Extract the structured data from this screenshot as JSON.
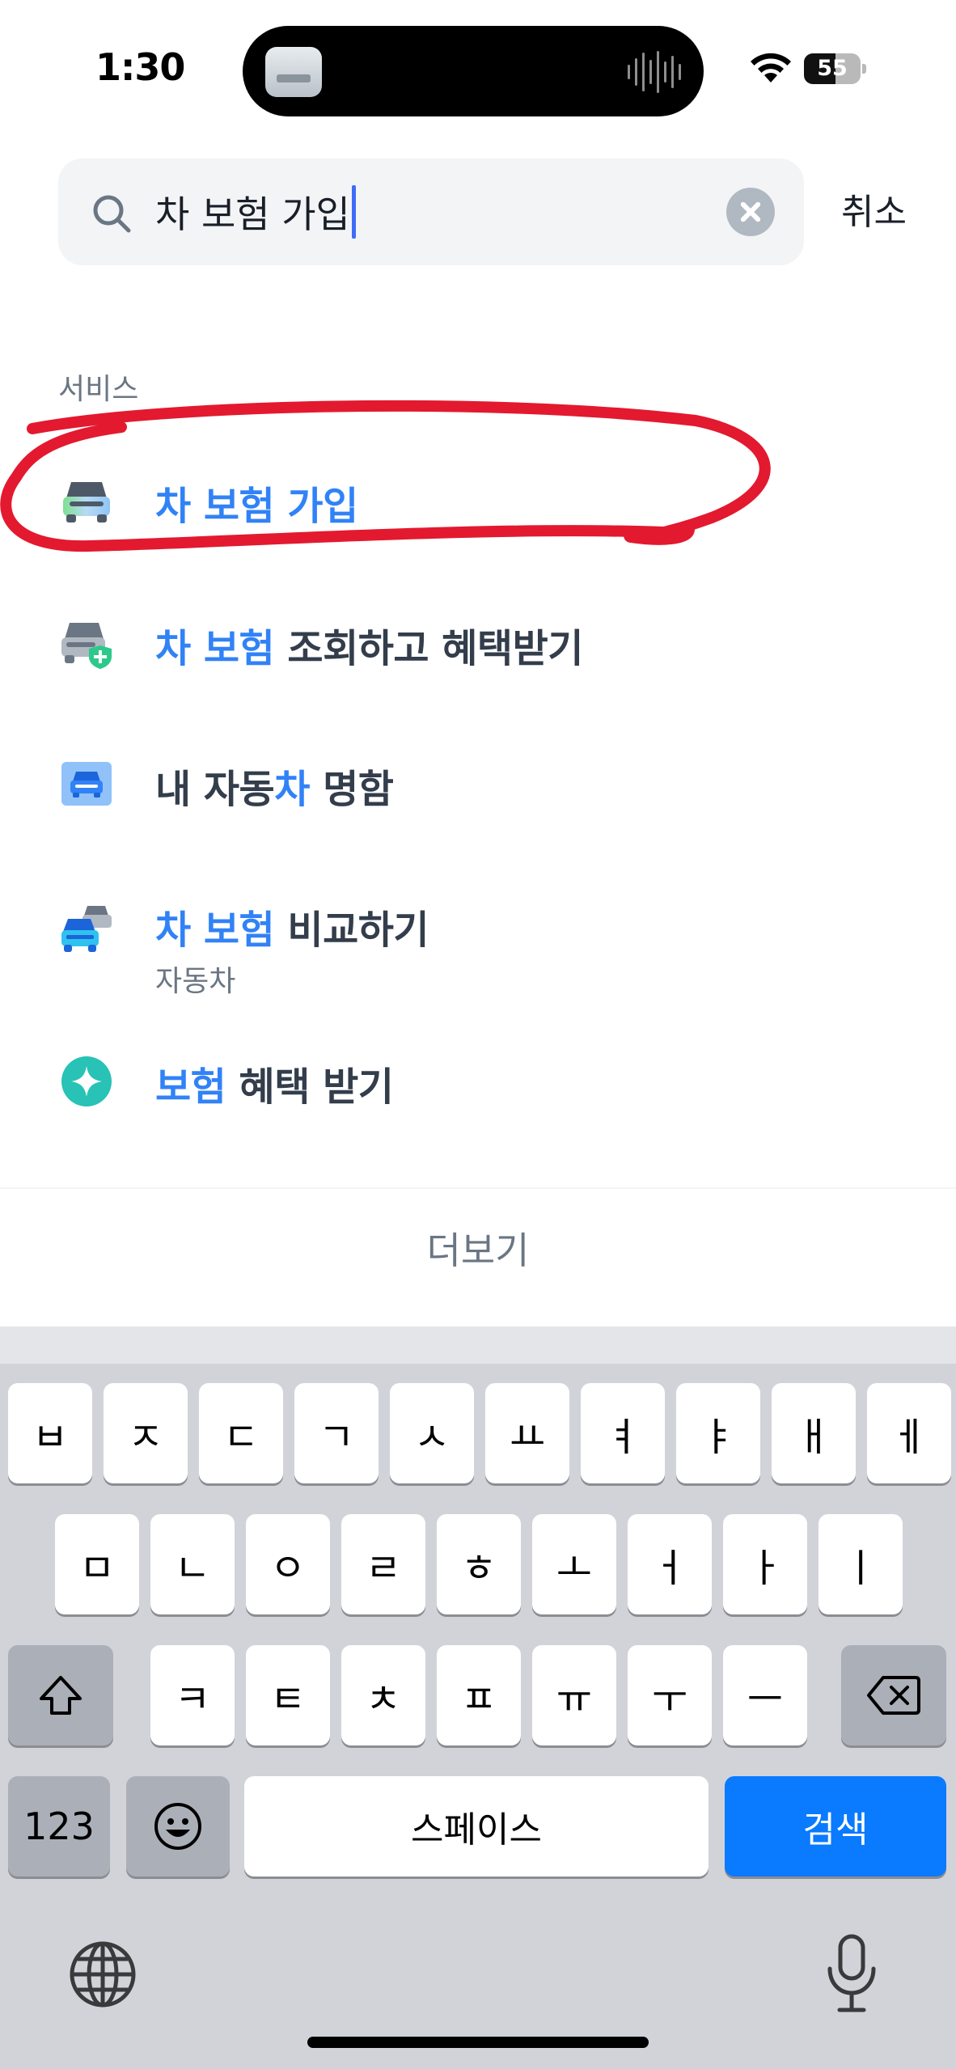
{
  "status_bar": {
    "time": "1:30",
    "battery_level": "55",
    "battery_fraction": 0.55
  },
  "search": {
    "query": "차 보험 가입",
    "cancel_label": "취소"
  },
  "section": {
    "label": "서비스"
  },
  "results": [
    {
      "title_highlight": "차 보험 가입",
      "title_rest": "",
      "subtitle": "",
      "icon": "car-icon"
    },
    {
      "title_highlight": "차 보험",
      "title_rest": " 조회하고 혜택받기",
      "subtitle": "",
      "icon": "car-shield-icon"
    },
    {
      "title_prefix": "내 자동",
      "title_highlight": "차",
      "title_rest": " 명함",
      "subtitle": "",
      "icon": "car-card-icon"
    },
    {
      "title_highlight": "차 보험",
      "title_rest": " 비교하기",
      "subtitle": "자동차",
      "icon": "cars-compare-icon"
    },
    {
      "title_highlight": "보험",
      "title_rest": " 혜택 받기",
      "subtitle": "",
      "icon": "sparkle-icon"
    }
  ],
  "more_label": "더보기",
  "keyboard": {
    "row1": [
      "ㅂ",
      "ㅈ",
      "ㄷ",
      "ㄱ",
      "ㅅ",
      "ㅛ",
      "ㅕ",
      "ㅑ",
      "ㅐ",
      "ㅔ"
    ],
    "row2": [
      "ㅁ",
      "ㄴ",
      "ㅇ",
      "ㄹ",
      "ㅎ",
      "ㅗ",
      "ㅓ",
      "ㅏ",
      "ㅣ"
    ],
    "row3": [
      "ㅋ",
      "ㅌ",
      "ㅊ",
      "ㅍ",
      "ㅠ",
      "ㅜ",
      "ㅡ"
    ],
    "numbers_label": "123",
    "space_label": "스페이스",
    "search_label": "검색"
  },
  "colors": {
    "highlight": "#3182f6",
    "annotation": "#e3192f",
    "search_key": "#0a7aff"
  }
}
